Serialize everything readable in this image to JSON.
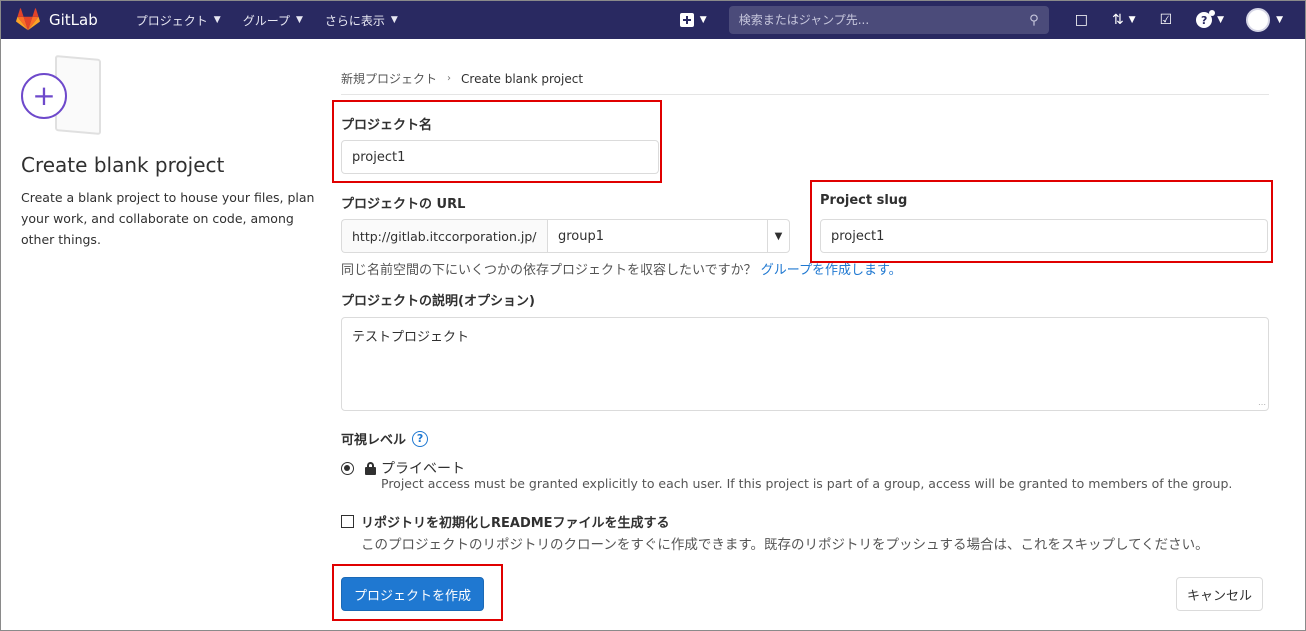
{
  "nav": {
    "brand": "GitLab",
    "items": [
      {
        "label": "プロジェクト"
      },
      {
        "label": "グループ"
      },
      {
        "label": "さらに表示"
      }
    ],
    "search_placeholder": "検索またはジャンプ先...",
    "accent": "#292961"
  },
  "left": {
    "title": "Create blank project",
    "description": "Create a blank project to house your files, plan your work, and collaborate on code, among other things."
  },
  "breadcrumb": {
    "parent": "新規プロジェクト",
    "current": "Create blank project"
  },
  "form": {
    "project_name_label": "プロジェクト名",
    "project_name_value": "project1",
    "project_url_label": "プロジェクトの URL",
    "url_prefix": "http://gitlab.itccorporation.jp/",
    "namespace_value": "group1",
    "slug_label": "Project slug",
    "slug_value": "project1",
    "namespace_help": "同じ名前空間の下にいくつかの依存プロジェクトを収容したいですか？",
    "namespace_help_link": "グループを作成します。",
    "description_label": "プロジェクトの説明(オプション)",
    "description_value": "テストプロジェクト",
    "visibility_label": "可視レベル",
    "visibility_option": "プライベート",
    "visibility_help": "Project access must be granted explicitly to each user. If this project is part of a group, access will be granted to members of the group.",
    "readme_label": "リポジトリを初期化しREADMEファイルを生成する",
    "readme_help": "このプロジェクトのリポジトリのクローンをすぐに作成できます。既存のリポジトリをプッシュする場合は、これをスキップしてください。",
    "submit_label": "プロジェクトを作成",
    "cancel_label": "キャンセル"
  },
  "colors": {
    "primary": "#1f78d1",
    "highlight": "#e00000"
  }
}
